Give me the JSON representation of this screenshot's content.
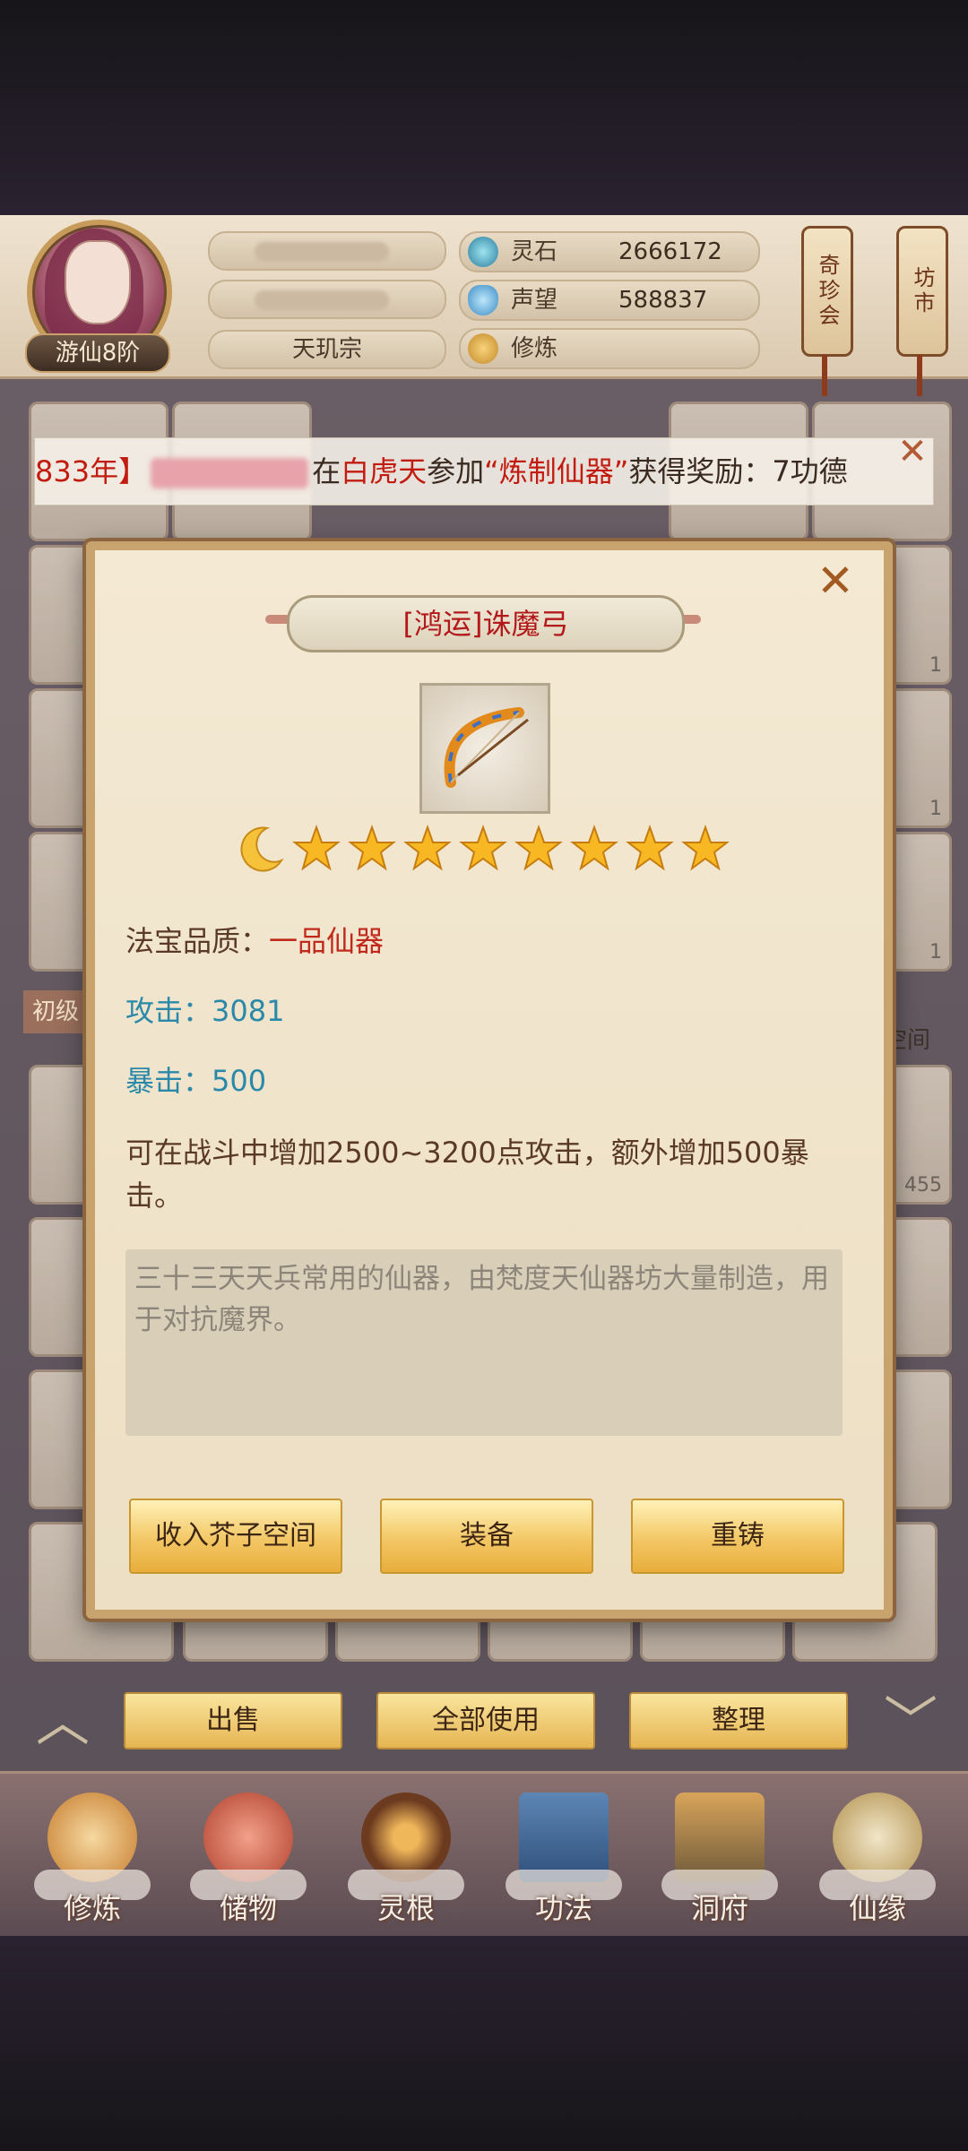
{
  "player": {
    "rank": "游仙8阶",
    "sect": "天玑宗"
  },
  "resources": [
    {
      "label": "灵石",
      "value": "2666172",
      "icon": "spirit-stone-icon"
    },
    {
      "label": "声望",
      "value": "588837",
      "icon": "prestige-icon"
    },
    {
      "label": "修炼",
      "value": "",
      "icon": "meditation-icon"
    }
  ],
  "top_buttons": {
    "treasure_fair": "奇珍会",
    "market": "坊市"
  },
  "marquee": {
    "prefix": "833年】",
    "middle": "在",
    "place": "白虎天",
    "action": "参加",
    "event": "“炼制仙器”",
    "suffix": "获得奖励：7功德"
  },
  "background_labels": {
    "side_tab": "初级",
    "jiezi": "子空间",
    "slot_count_a": "1",
    "slot_count_b": "1",
    "slot_count_c": "1",
    "count_455": "455"
  },
  "modal": {
    "title": "[鸿运]诛魔弓",
    "item_icon": "bow-icon",
    "moon_icon": "moon-icon",
    "star_count": 8,
    "quality_label": "法宝品质：",
    "quality_value": "一品仙器",
    "attack": "攻击：3081",
    "crit": "暴击：500",
    "effect": "可在战斗中增加2500~3200点攻击，额外增加500暴击。",
    "lore": "三十三天天兵常用的仙器，由梵度天仙器坊大量制造，用于对抗魔界。",
    "buttons": {
      "store": "收入芥子空间",
      "equip": "装备",
      "reforge": "重铸"
    }
  },
  "action_bar": {
    "sell": "出售",
    "use_all": "全部使用",
    "sort": "整理"
  },
  "nav": [
    {
      "label": "修炼",
      "icon": "cultivate-icon"
    },
    {
      "label": "储物",
      "icon": "storage-bag-icon"
    },
    {
      "label": "灵根",
      "icon": "spirit-root-icon"
    },
    {
      "label": "功法",
      "icon": "technique-book-icon"
    },
    {
      "label": "洞府",
      "icon": "cave-dwelling-icon"
    },
    {
      "label": "仙缘",
      "icon": "immortal-fate-icon"
    }
  ],
  "colors": {
    "accent_red": "#c0291c",
    "stat_blue": "#2a89a9",
    "button_gold": "#f3c765"
  }
}
